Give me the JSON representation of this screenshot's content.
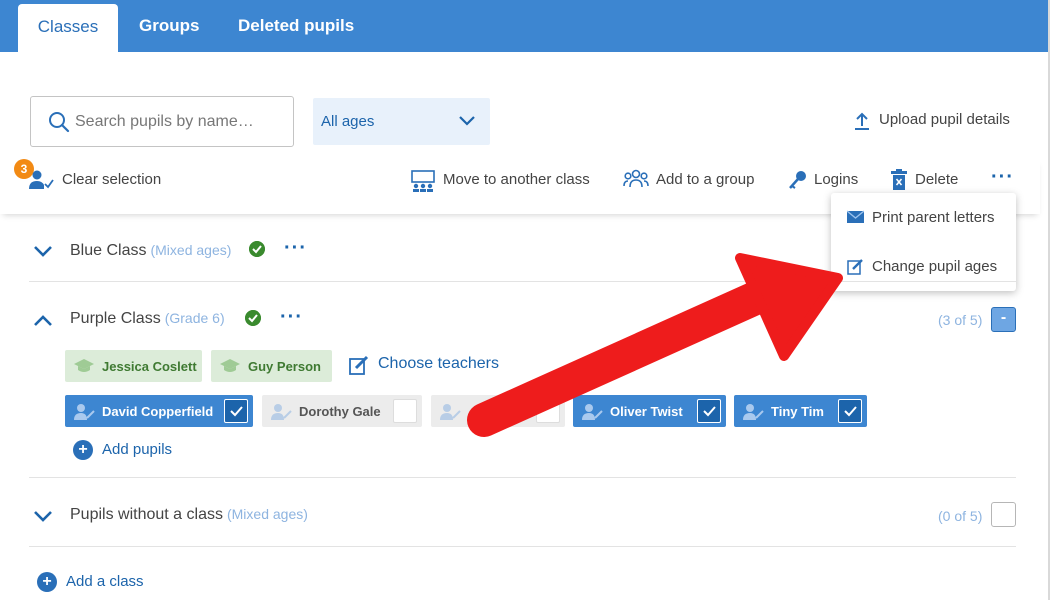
{
  "tabs": [
    {
      "label": "Classes",
      "active": true
    },
    {
      "label": "Groups",
      "active": false
    },
    {
      "label": "Deleted pupils",
      "active": false
    }
  ],
  "toolbar": {
    "search_placeholder": "Search pupils by name…",
    "age_filter": "All ages",
    "upload_label": "Upload pupil details"
  },
  "actions": {
    "selected_count": "3",
    "clear_selection": "Clear selection",
    "move": "Move to another class",
    "add_group": "Add to a group",
    "logins": "Logins",
    "delete": "Delete"
  },
  "menu": {
    "print_letters": "Print parent letters",
    "change_ages": "Change pupil ages"
  },
  "classes": {
    "blue": {
      "name": "Blue Class",
      "age": "(Mixed ages)"
    },
    "purple": {
      "name": "Purple Class",
      "age": "(Grade 6)",
      "count": "(3 of 5)",
      "teachers": [
        "Jessica Coslett",
        "Guy Person"
      ],
      "choose_teachers": "Choose teachers",
      "pupils": [
        {
          "name": "David Copperfield",
          "selected": true
        },
        {
          "name": "Dorothy Gale",
          "selected": false
        },
        {
          "name": "",
          "selected": false
        },
        {
          "name": "Oliver Twist",
          "selected": true
        },
        {
          "name": "Tiny Tim",
          "selected": true
        }
      ],
      "add_pupils": "Add pupils"
    },
    "unassigned": {
      "name": "Pupils without a class",
      "age": "(Mixed ages)",
      "count": "(0 of 5)"
    }
  },
  "add_class": "Add a class",
  "colors": {
    "brand": "#3d86d1",
    "link": "#1c64ab",
    "teacher": "#dcecd9",
    "annotation": "#ee1c1c"
  }
}
